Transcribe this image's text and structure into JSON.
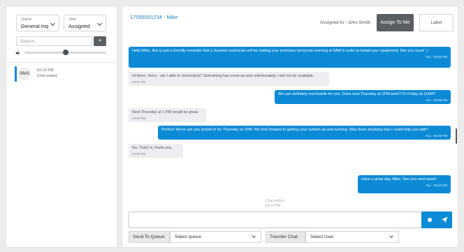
{
  "filters": {
    "queue": {
      "caption": "Queue",
      "value": "General Inq"
    },
    "view": {
      "caption": "View",
      "value": "Assigned"
    }
  },
  "search": {
    "placeholder": "Search...",
    "add_label": "+"
  },
  "conversation_list": [
    {
      "channel": "SMS",
      "time": "03:10 PM",
      "snippet": "Chat ended."
    }
  ],
  "chat": {
    "phone_name": "17055551234 - Mike",
    "assigned_to": "Assigned to - John Smith",
    "assign_to_me": "Assign To Me",
    "label_button": "Label",
    "messages": [
      {
        "dir": "out",
        "text": "Hello Mike, this is just a friendly reminder that a Sunwire technician will be visiting your premises tomorrow morning at 9AM in order to install your equipment. See you soon! :)",
        "time": "You - 03:05 PM"
      },
      {
        "dir": "in",
        "text": "Hi there, Sorry - am I able to reschedule? Something has come up and unfortunately, I will not be available.",
        "time": "03:07 PM"
      },
      {
        "dir": "out",
        "text": "We can definitely reschedule for you. Does next Thursday at 1PM work? Or Friday at 11AM?",
        "time": "You - 03:08 PM"
      },
      {
        "dir": "in",
        "text": "Next Thursday at 1 PM would be great.",
        "time": "03:08 PM"
      },
      {
        "dir": "out",
        "text": "Perfect! We've got you locked in for Thursday at 1PM. We look forward to getting your system up and running. Was there anything else I could help you with?",
        "time": "You - 03:09 PM"
      },
      {
        "dir": "in",
        "text": "No. That's it, thank you.",
        "time": "03:09 PM"
      },
      {
        "dir": "out",
        "text": "Have a great day, Mike. See you next week!",
        "time": "You - 03:10 PM"
      }
    ],
    "system": {
      "text": "Chat ended.",
      "time": "03:10 PM"
    },
    "composer_placeholder": ""
  },
  "footer": {
    "send_to_queue_label": "Send To Queue:",
    "send_to_queue_value": "Select queue",
    "transfer_label": "Transfer Chat:",
    "transfer_value": "Select User"
  },
  "colors": {
    "accent": "#0c8ad6",
    "dark_button": "#5b5f63",
    "incoming_bubble": "#ececf1"
  }
}
